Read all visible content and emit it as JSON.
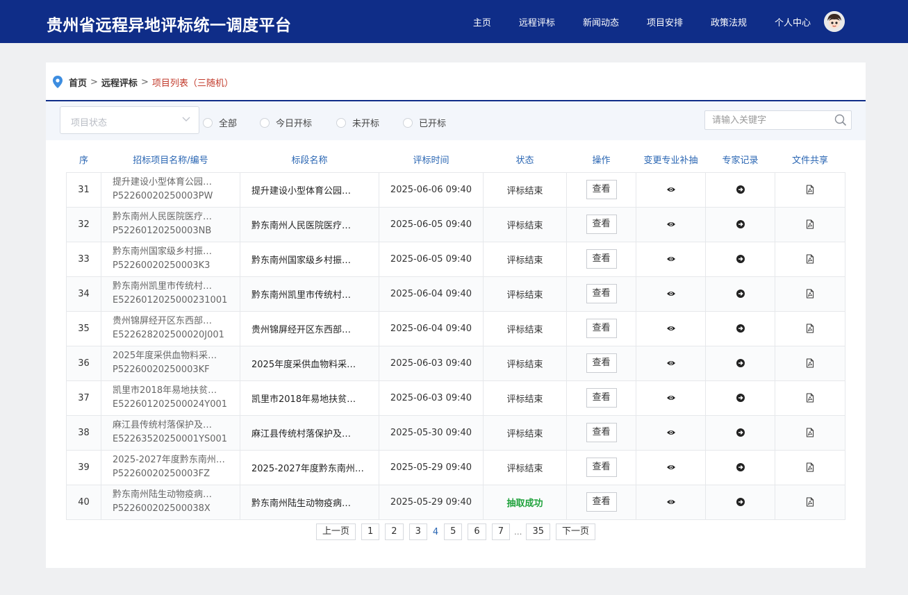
{
  "header": {
    "brand": "贵州省远程异地评标统一调度平台",
    "nav": [
      "主页",
      "远程评标",
      "新闻动态",
      "项目安排",
      "政策法规",
      "个人中心"
    ]
  },
  "breadcrumb": {
    "home": "首页",
    "section": "远程评标",
    "current": "项目列表（三随机）",
    "sep": ">"
  },
  "filter": {
    "status_placeholder": "项目状态",
    "radios": [
      "全部",
      "今日开标",
      "未开标",
      "已开标"
    ],
    "search_placeholder": "请输入关键字"
  },
  "table": {
    "headers": [
      "序",
      "招标项目名称/编号",
      "标段名称",
      "评标时间",
      "状态",
      "操作",
      "变更专业补抽",
      "专家记录",
      "文件共享"
    ],
    "view_label": "查看",
    "rows": [
      {
        "no": "31",
        "name": "提升建设小型体育公园…",
        "code": "P52260020250003PW",
        "section": "提升建设小型体育公园…",
        "time": "2025-06-06 09:40",
        "status": "评标结束",
        "ok": false
      },
      {
        "no": "32",
        "name": "黔东南州人民医院医疗…",
        "code": "P52260120250003NB",
        "section": "黔东南州人民医院医疗…",
        "time": "2025-06-05 09:40",
        "status": "评标结束",
        "ok": false
      },
      {
        "no": "33",
        "name": "黔东南州国家级乡村振…",
        "code": "P52260020250003K3",
        "section": "黔东南州国家级乡村振…",
        "time": "2025-06-05 09:40",
        "status": "评标结束",
        "ok": false
      },
      {
        "no": "34",
        "name": "黔东南州凯里市传统村…",
        "code": "E5226012025000231001",
        "section": "黔东南州凯里市传统村…",
        "time": "2025-06-04 09:40",
        "status": "评标结束",
        "ok": false
      },
      {
        "no": "35",
        "name": "贵州锦屏经开区东西部…",
        "code": "E522628202500020J001",
        "section": "贵州锦屏经开区东西部…",
        "time": "2025-06-04 09:40",
        "status": "评标结束",
        "ok": false
      },
      {
        "no": "36",
        "name": "2025年度采供血物料采…",
        "code": "P52260020250003KF",
        "section": "2025年度采供血物料采…",
        "time": "2025-06-03 09:40",
        "status": "评标结束",
        "ok": false
      },
      {
        "no": "37",
        "name": "凯里市2018年易地扶贫…",
        "code": "E522601202500024Y001",
        "section": "凯里市2018年易地扶贫…",
        "time": "2025-06-03 09:40",
        "status": "评标结束",
        "ok": false
      },
      {
        "no": "38",
        "name": "麻江县传统村落保护及…",
        "code": "E52263520250001YS001",
        "section": "麻江县传统村落保护及…",
        "time": "2025-05-30 09:40",
        "status": "评标结束",
        "ok": false
      },
      {
        "no": "39",
        "name": "2025-2027年度黔东南州…",
        "code": "P52260020250003FZ",
        "section": "2025-2027年度黔东南州…",
        "time": "2025-05-29 09:40",
        "status": "评标结束",
        "ok": false
      },
      {
        "no": "40",
        "name": "黔东南州陆生动物疫病…",
        "code": "P522600202500038X",
        "section": "黔东南州陆生动物疫病…",
        "time": "2025-05-29 09:40",
        "status": "抽取成功",
        "ok": true
      }
    ]
  },
  "pagination": {
    "prev": "上一页",
    "next": "下一页",
    "pages_before": [
      "1",
      "2",
      "3"
    ],
    "current": "4",
    "pages_after": [
      "5",
      "6",
      "7"
    ],
    "ellipsis": "...",
    "last": "35"
  },
  "colors": {
    "header_bg": "#0f2d88",
    "accent_blue": "#2a66b3",
    "breadcrumb_current": "#c23a2b",
    "status_success": "#20a23c"
  }
}
